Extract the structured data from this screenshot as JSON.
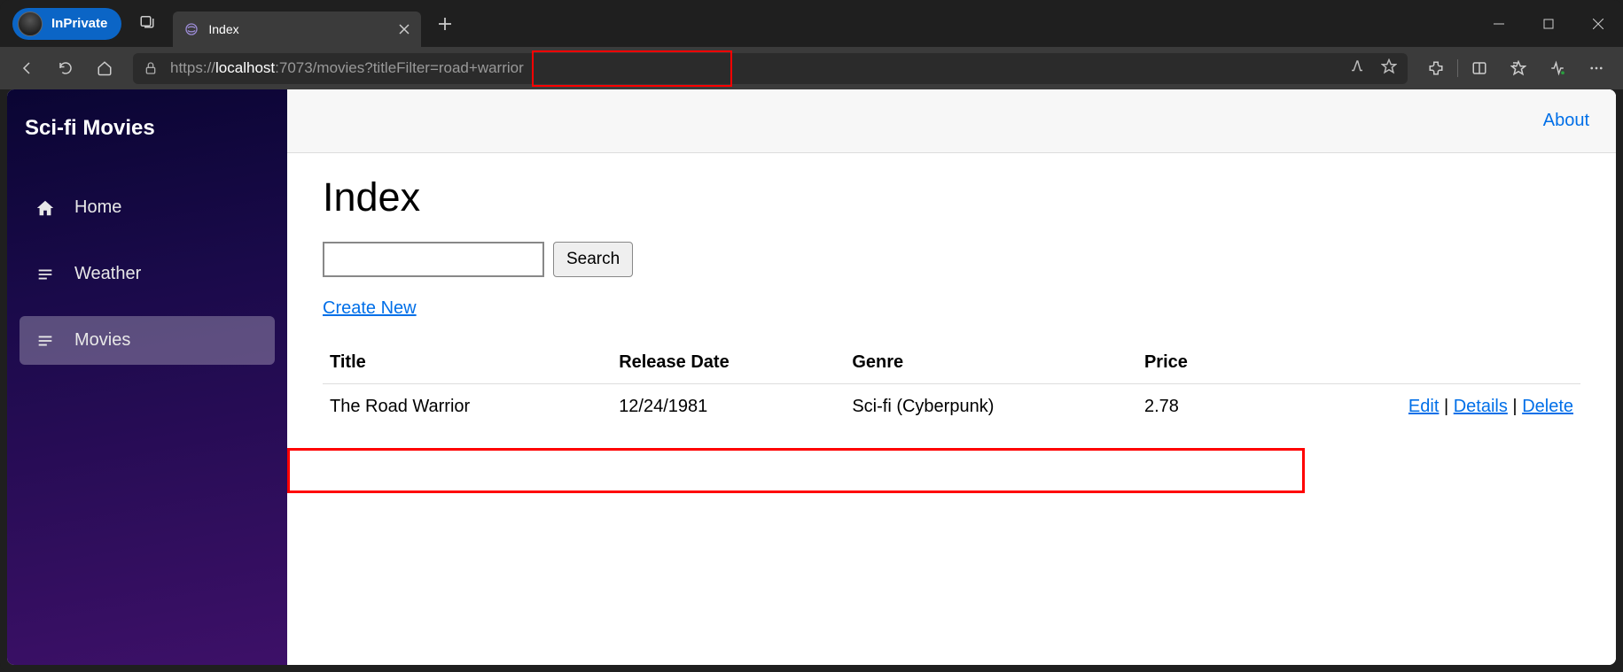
{
  "browser": {
    "inprivate_label": "InPrivate",
    "tab_title": "Index",
    "url_prefix": "https://",
    "url_host": "localhost",
    "url_path": ":7073/movies?titleFilter=road+warrior"
  },
  "sidebar": {
    "brand": "Sci-fi Movies",
    "items": [
      {
        "label": "Home"
      },
      {
        "label": "Weather"
      },
      {
        "label": "Movies"
      }
    ]
  },
  "topbar": {
    "about": "About"
  },
  "page": {
    "heading": "Index",
    "search_button": "Search",
    "create_new": "Create New",
    "columns": {
      "title": "Title",
      "release_date": "Release Date",
      "genre": "Genre",
      "price": "Price"
    },
    "rows": [
      {
        "title": "The Road Warrior",
        "release_date": "12/24/1981",
        "genre": "Sci-fi (Cyberpunk)",
        "price": "2.78"
      }
    ],
    "actions": {
      "edit": "Edit",
      "details": "Details",
      "delete": "Delete"
    }
  }
}
